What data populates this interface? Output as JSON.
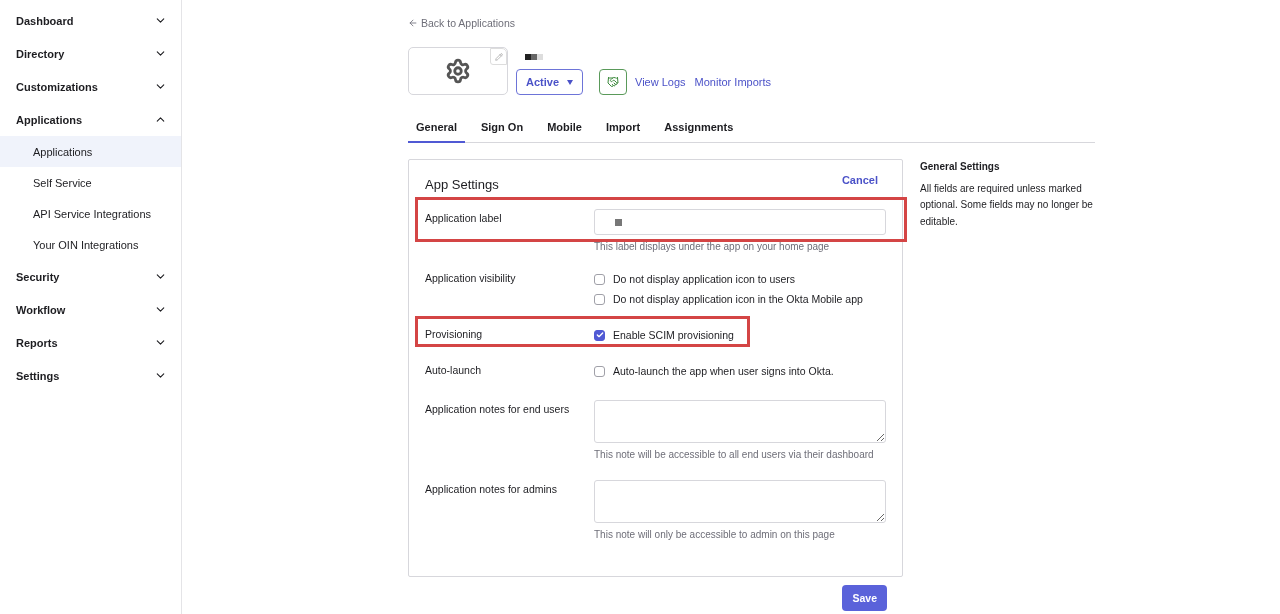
{
  "sidebar": {
    "items": [
      {
        "label": "Dashboard",
        "expanded": false
      },
      {
        "label": "Directory",
        "expanded": false
      },
      {
        "label": "Customizations",
        "expanded": false
      },
      {
        "label": "Applications",
        "expanded": true,
        "children": [
          {
            "label": "Applications",
            "selected": true
          },
          {
            "label": "Self Service",
            "selected": false
          },
          {
            "label": "API Service Integrations",
            "selected": false
          },
          {
            "label": "Your OIN Integrations",
            "selected": false
          }
        ]
      },
      {
        "label": "Security",
        "expanded": false
      },
      {
        "label": "Workflow",
        "expanded": false
      },
      {
        "label": "Reports",
        "expanded": false
      },
      {
        "label": "Settings",
        "expanded": false
      }
    ]
  },
  "back_link": "Back to Applications",
  "app_header": {
    "status": "Active",
    "links": [
      "View Logs",
      "Monitor Imports"
    ]
  },
  "tabs": [
    {
      "label": "General",
      "selected": true
    },
    {
      "label": "Sign On",
      "selected": false
    },
    {
      "label": "Mobile",
      "selected": false
    },
    {
      "label": "Import",
      "selected": false
    },
    {
      "label": "Assignments",
      "selected": false
    }
  ],
  "settings": {
    "title": "App Settings",
    "cancel": "Cancel",
    "fields": [
      {
        "kind": "text",
        "label": "Application label",
        "highlighted": true,
        "hint": "This label displays under the app on your home page"
      },
      {
        "kind": "checkboxes",
        "label": "Application visibility",
        "highlighted": false,
        "options": [
          {
            "label": "Do not display application icon to users",
            "checked": false
          },
          {
            "label": "Do not display application icon in the Okta Mobile app",
            "checked": false
          }
        ]
      },
      {
        "kind": "checkboxes",
        "label": "Provisioning",
        "highlighted": true,
        "options": [
          {
            "label": "Enable SCIM provisioning",
            "checked": true
          }
        ]
      },
      {
        "kind": "checkboxes",
        "label": "Auto-launch",
        "highlighted": false,
        "options": [
          {
            "label": "Auto-launch the app when user signs into Okta.",
            "checked": false
          }
        ]
      },
      {
        "kind": "textarea",
        "label": "Application notes for end users",
        "highlighted": false,
        "hint": "This note will be accessible to all end users via their dashboard"
      },
      {
        "kind": "textarea",
        "label": "Application notes for admins",
        "highlighted": false,
        "hint": "This note will only be accessible to admin on this page"
      }
    ],
    "save": "Save"
  },
  "help": {
    "title": "General Settings",
    "text": "All fields are required unless marked optional. Some fields may no longer be editable."
  }
}
